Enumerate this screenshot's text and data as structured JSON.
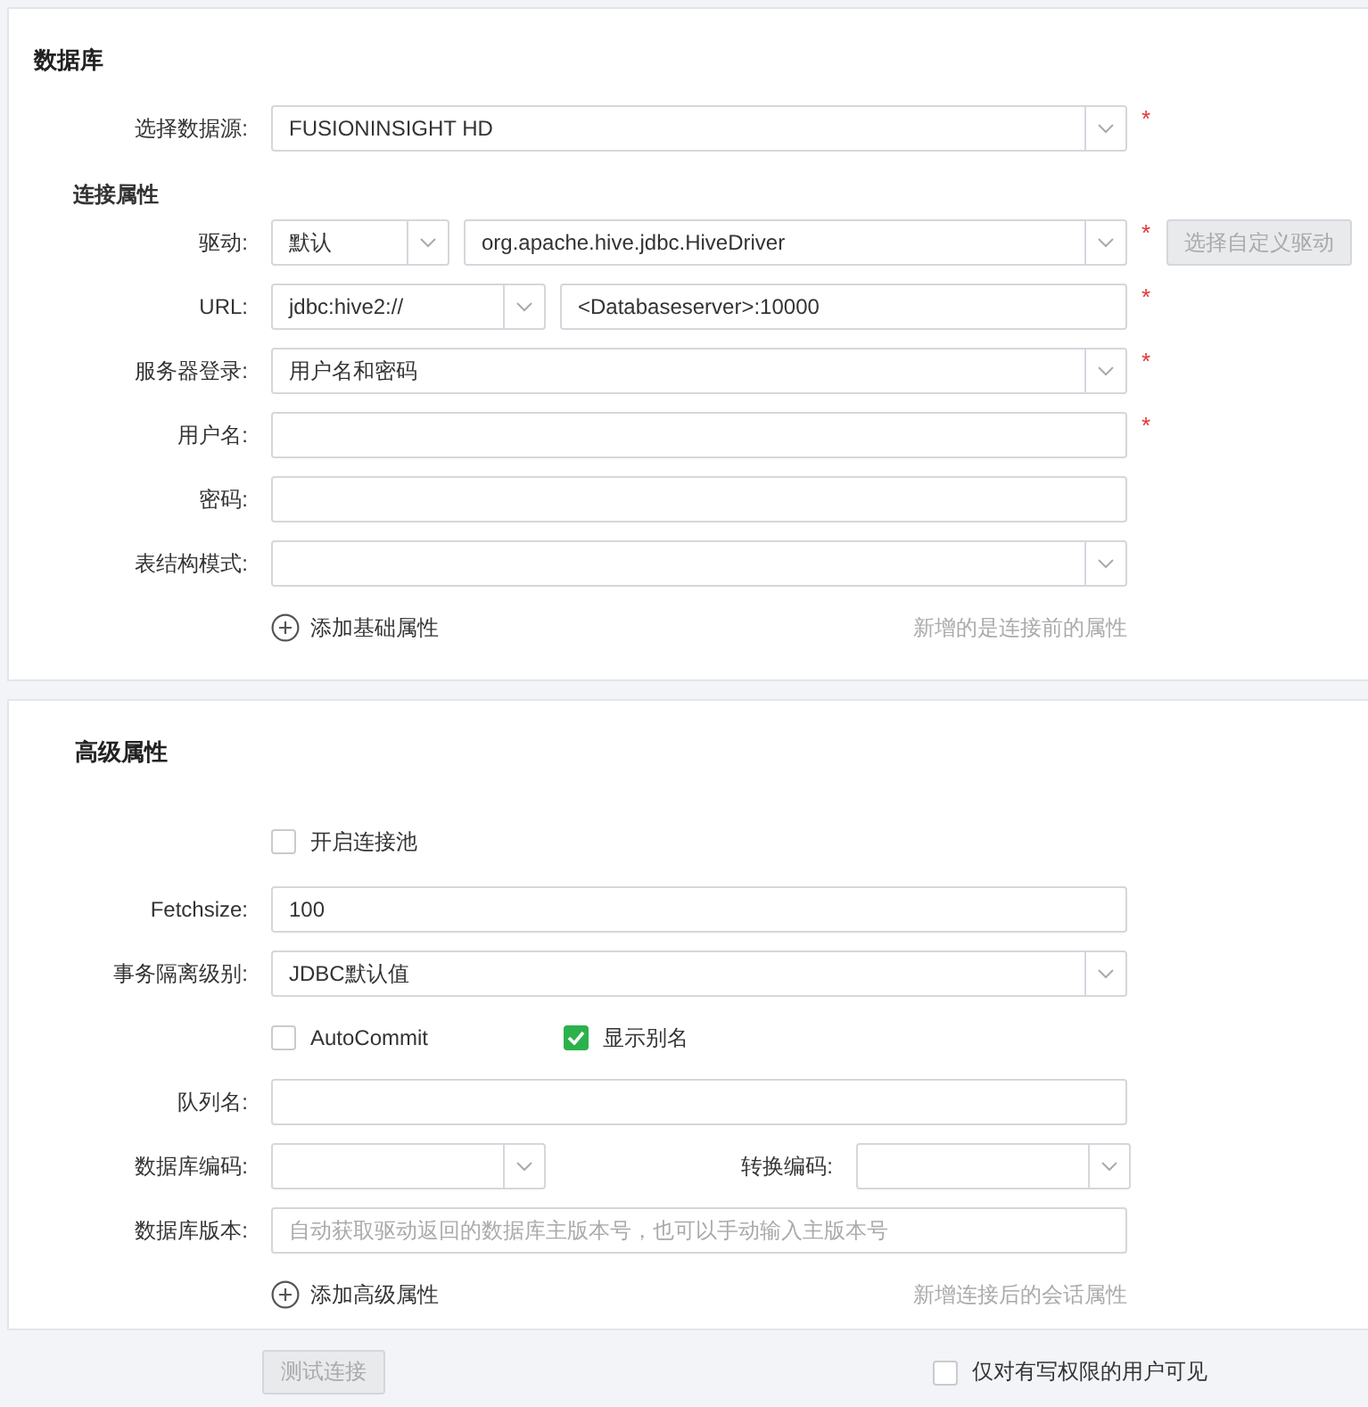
{
  "sections": [
    {
      "title": "数据库",
      "rows": [
        {
          "kind": "select",
          "label": "选择数据源:",
          "value": "FUSIONINSIGHT HD",
          "mark": "*"
        },
        {
          "kind": "heading",
          "text": "连接属性"
        },
        {
          "kind": "driver",
          "label": "驱动:",
          "first": "默认",
          "second": "org.apache.hive.jdbc.HiveDriver",
          "mark": "*",
          "button": {
            "label": "选择自定义驱动",
            "disabled": true
          }
        },
        {
          "kind": "url",
          "label": "URL:",
          "first": "jdbc:hive2://",
          "second": "<Databaseserver>:10000",
          "mark": "*"
        },
        {
          "kind": "select",
          "label": "服务器登录:",
          "value": "用户名和密码",
          "mark": "*"
        },
        {
          "kind": "input",
          "label": "用户名:",
          "value": "",
          "mark": "*"
        },
        {
          "kind": "input",
          "label": "密码:",
          "value": ""
        },
        {
          "kind": "select",
          "label": "表结构模式:",
          "value": ""
        },
        {
          "kind": "add",
          "text": "添加基础属性",
          "hint": "新增的是连接前的属性"
        }
      ]
    },
    {
      "title": "高级属性",
      "rows": [
        {
          "kind": "checkbox",
          "text": "开启连接池",
          "checked": false
        },
        {
          "kind": "input",
          "label": "Fetchsize:",
          "value": "100"
        },
        {
          "kind": "select",
          "label": "事务隔离级别:",
          "value": "JDBC默认值"
        },
        {
          "kind": "checkbox-pair",
          "items": [
            {
              "text": "AutoCommit",
              "checked": false
            },
            {
              "text": "显示别名",
              "checked": true
            }
          ]
        },
        {
          "kind": "input",
          "label": "队列名:",
          "value": ""
        },
        {
          "kind": "encoding",
          "label": "数据库编码:",
          "value": "",
          "label2": "转换编码:",
          "value2": ""
        },
        {
          "kind": "input",
          "label": "数据库版本:",
          "value": "",
          "placeholder": "自动获取驱动返回的数据库主版本号，也可以手动输入主版本号"
        },
        {
          "kind": "add",
          "text": "添加高级属性",
          "hint": "新增连接后的会话属性"
        }
      ]
    }
  ],
  "footer": {
    "button": {
      "label": "测试连接",
      "disabled": true
    },
    "checkbox": {
      "text": "仅对有写权限的用户可见",
      "checked": false
    }
  }
}
